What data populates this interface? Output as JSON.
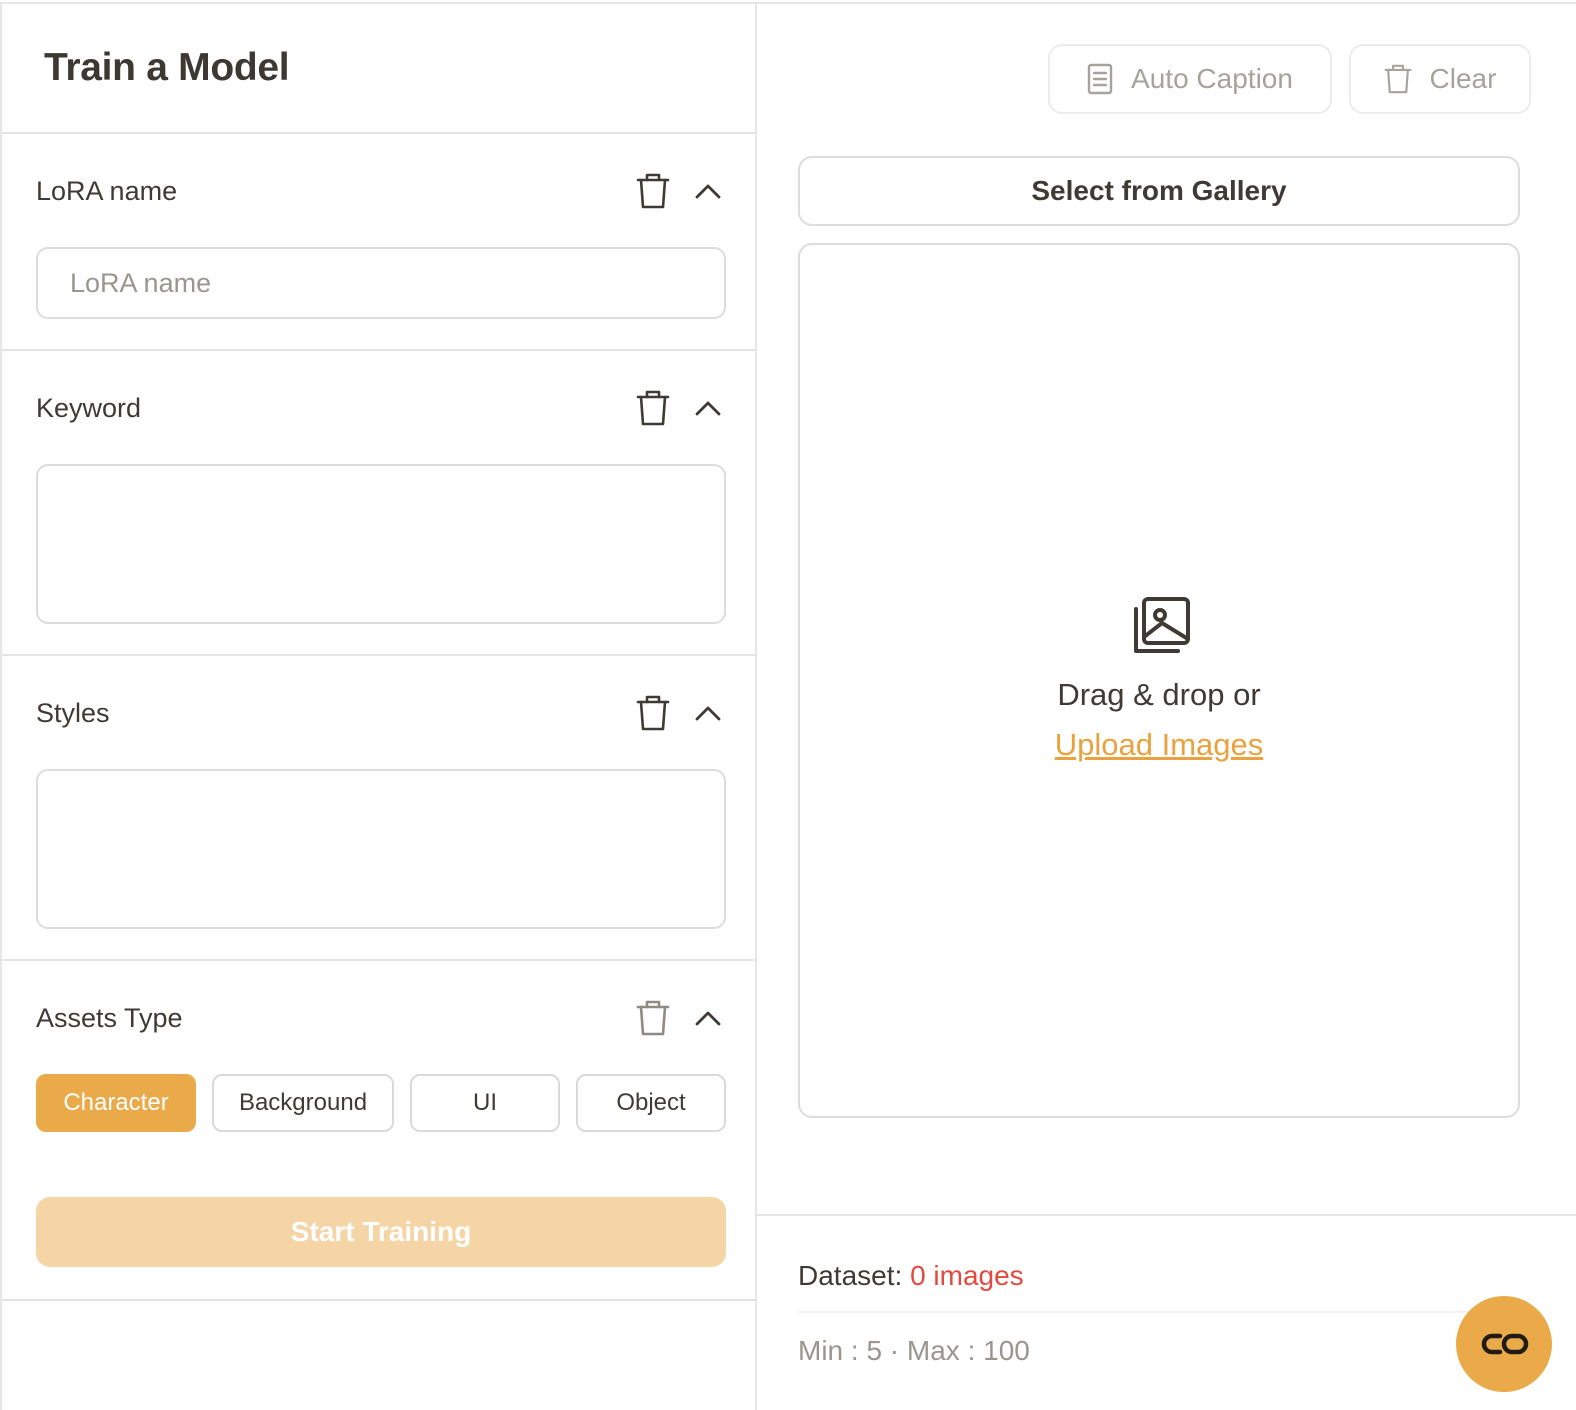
{
  "page": {
    "title": "Train a Model"
  },
  "sections": {
    "lora_name": {
      "label": "LoRA name",
      "placeholder": "LoRA name",
      "value": ""
    },
    "keyword": {
      "label": "Keyword",
      "value": ""
    },
    "styles": {
      "label": "Styles",
      "value": ""
    },
    "assets_type": {
      "label": "Assets Type",
      "options": [
        "Character",
        "Background",
        "UI",
        "Object"
      ],
      "selected": "Character"
    }
  },
  "actions": {
    "start_training": "Start Training",
    "auto_caption": "Auto Caption",
    "clear": "Clear",
    "select_from_gallery": "Select from Gallery"
  },
  "dropzone": {
    "text": "Drag & drop or",
    "link": "Upload Images"
  },
  "dataset": {
    "label": "Dataset:",
    "count_text": "0 images",
    "limits": "Min : 5 · Max : 100"
  },
  "icons": {
    "trash": "trash-icon",
    "chevron": "chevron-up-icon",
    "document": "document-icon",
    "gallery": "image-gallery-icon",
    "fab": "link-icon"
  },
  "colors": {
    "accent": "#eaaa4a",
    "accent_disabled": "#f5d5a5",
    "link": "#eaa23f",
    "danger": "#e24a3f",
    "text": "#3f3a33",
    "muted": "#9a958e"
  }
}
